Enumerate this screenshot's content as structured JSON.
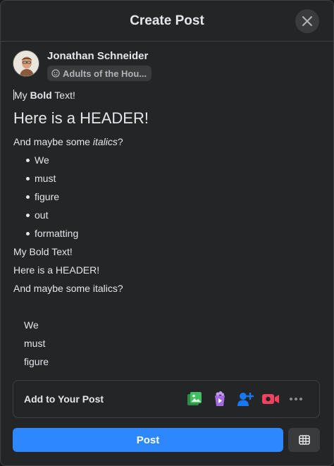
{
  "dialog": {
    "title": "Create Post"
  },
  "author": {
    "name": "Jonathan Schneider",
    "audience": "Adults of the Hou..."
  },
  "editor": {
    "line1_prefix": "My ",
    "line1_bold": "Bold",
    "line1_suffix": " Text!",
    "header": "Here is a HEADER!",
    "line3_prefix": "And maybe some ",
    "line3_italic": "italics",
    "line3_suffix": "?",
    "bullets": [
      "We",
      "must",
      "figure",
      "out",
      "formatting"
    ],
    "plain_lines": [
      "My Bold Text!",
      "Here is a HEADER!",
      "And maybe some italics?"
    ],
    "indented_lines": [
      "We",
      "must",
      "figure"
    ]
  },
  "add_to_post": {
    "label": "Add to Your Post",
    "tools": [
      "photo-video-icon",
      "gif-icon",
      "tag-people-icon",
      "live-video-icon",
      "more-icon"
    ]
  },
  "actions": {
    "post_label": "Post"
  },
  "colors": {
    "accent": "#2d88ff",
    "surface": "#242526",
    "photo": "#45bd62",
    "gif": "#a56ae0",
    "tag": "#1877f2",
    "live": "#f3425f"
  }
}
